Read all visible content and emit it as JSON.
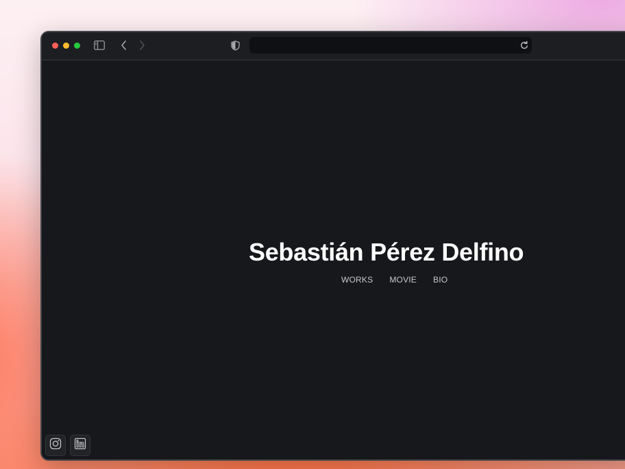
{
  "browser": {
    "address": {
      "value": ""
    },
    "icons": [
      "sidebar-icon",
      "chevron-left-icon",
      "chevron-right-icon",
      "shield-icon",
      "reload-icon"
    ]
  },
  "page": {
    "name": "Sebastián Pérez Delfino",
    "nav": {
      "works": "WORKS",
      "movie": "MOVIE",
      "bio": "BIO"
    },
    "social": [
      "instagram-icon",
      "linkedin-icon"
    ]
  },
  "colors": {
    "page_background": "#17181c",
    "toolbar": "#1d1e21",
    "title_text": "#ffffff",
    "nav_text": "#c9cacd",
    "traffic_red": "#fe5f57",
    "traffic_yellow": "#febc2e",
    "traffic_green": "#28c840"
  }
}
